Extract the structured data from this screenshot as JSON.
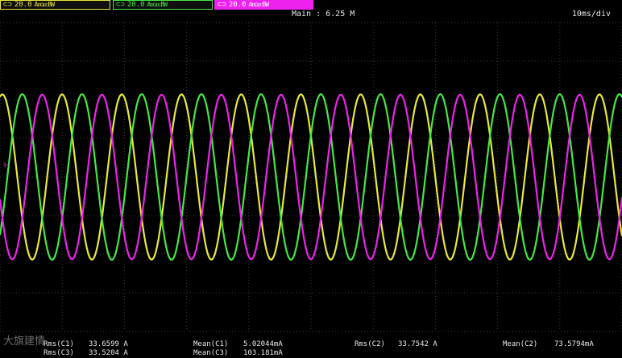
{
  "channels": [
    {
      "id": "ch1",
      "symbol": "⊂⊃",
      "scale": "20.0",
      "coupling": "A",
      "suffix": "AᴅɢᴅᴄBW",
      "color": "#e8e83a"
    },
    {
      "id": "ch2",
      "symbol": "⊂⊃",
      "scale": "20.0",
      "coupling": "A",
      "suffix": "AᴅɢᴅᴄBW",
      "color": "#43e843"
    },
    {
      "id": "ch3",
      "symbol": "⊂⊃",
      "scale": "20.0",
      "coupling": "A",
      "suffix": "AᴅɢᴅᴄBW",
      "color": "#ee22ee"
    }
  ],
  "timebase": {
    "main": "Main : 6.25  M",
    "per_div": "10ms/div"
  },
  "trigger_marker": "⊩",
  "measurements": {
    "rms_c1_label": "Rms(C1)",
    "rms_c1_value": "33.6599 A",
    "rms_c3_label": "Rms(C3)",
    "rms_c3_value": "33.5204 A",
    "mean_c1_label": "Mean(C1)",
    "mean_c1_value": "5.02044mA",
    "mean_c3_label": "Mean(C3)",
    "mean_c3_value": "103.181mA",
    "rms_c2_label": "Rms(C2)",
    "rms_c2_value": "33.7542 A",
    "mean_c2_label": "Mean(C2)",
    "mean_c2_value": "73.5794mA"
  },
  "watermark": "大旗建情",
  "colors": {
    "background": "#000000",
    "grid": "#3a3a3a",
    "ch1": "#e8e83a",
    "ch2": "#43e843",
    "ch3": "#ee22ee"
  },
  "chart_data": {
    "type": "line",
    "title": "",
    "xlabel": "",
    "ylabel": "",
    "x_unit": "ms",
    "x_per_div": 10,
    "x_divisions": 10,
    "y_divisions": 8,
    "grid": true,
    "series": [
      {
        "channel": "C1",
        "waveform": "sine",
        "amplitude_A": 47.6,
        "period_ms": 9.6,
        "phase_deg": 0,
        "color": "#e8e83a"
      },
      {
        "channel": "C2",
        "waveform": "sine",
        "amplitude_A": 47.7,
        "period_ms": 9.6,
        "phase_deg": -120,
        "color": "#43e843"
      },
      {
        "channel": "C3",
        "waveform": "sine",
        "amplitude_A": 47.4,
        "period_ms": 9.6,
        "phase_deg": 120,
        "color": "#ee22ee"
      }
    ]
  }
}
